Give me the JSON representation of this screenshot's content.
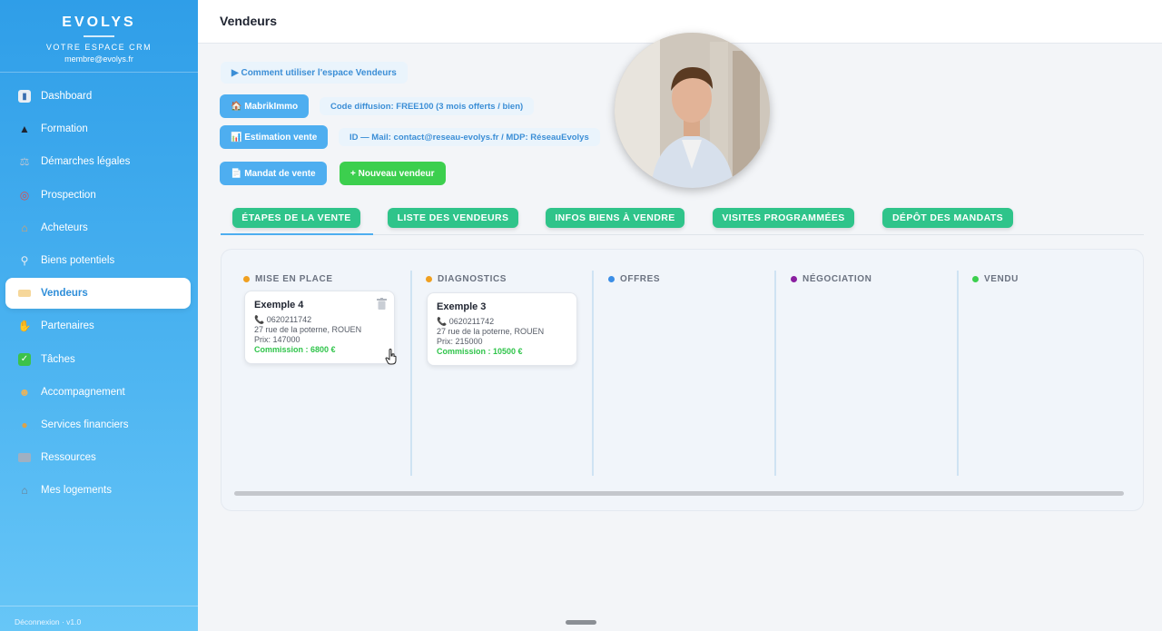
{
  "brand": {
    "title": "EVOLYS",
    "subtitle": "VOTRE ESPACE CRM",
    "email": "membre@evolys.fr"
  },
  "sidebar": {
    "items": [
      {
        "label": "Dashboard",
        "icon": "chart-icon"
      },
      {
        "label": "Formation",
        "icon": "graduation-cap-icon"
      },
      {
        "label": "Démarches légales",
        "icon": "scales-icon"
      },
      {
        "label": "Prospection",
        "icon": "target-icon"
      },
      {
        "label": "Acheteurs",
        "icon": "house-icon"
      },
      {
        "label": "Biens potentiels",
        "icon": "magnifier-icon"
      },
      {
        "label": "Vendeurs",
        "icon": "tag-icon",
        "active": true
      },
      {
        "label": "Partenaires",
        "icon": "handshake-icon"
      },
      {
        "label": "Tâches",
        "icon": "check-icon"
      },
      {
        "label": "Accompagnement",
        "icon": "people-icon"
      },
      {
        "label": "Services financiers",
        "icon": "money-bag-icon"
      },
      {
        "label": "Ressources",
        "icon": "folder-icon"
      },
      {
        "label": "Mes logements",
        "icon": "houses-icon"
      }
    ],
    "footer": "Déconnexion · v1.0"
  },
  "header": {
    "title": "Vendeurs"
  },
  "help_link": "▶ Comment utiliser l'espace Vendeurs",
  "actions": {
    "mabrikimmo": "🏠 MabrikImmo",
    "mabrikimmo_info": "Code diffusion: FREE100 (3 mois offerts / bien)",
    "estimation": "📊 Estimation vente",
    "estimation_info": "ID — Mail: contact@reseau-evolys.fr / MDP: RéseauEvolys",
    "mandat": "📄 Mandat de vente",
    "new_seller": "+ Nouveau vendeur"
  },
  "tabs": [
    {
      "label": "ÉTAPES DE LA VENTE",
      "active": true
    },
    {
      "label": "LISTE DES VENDEURS"
    },
    {
      "label": "INFOS BIENS À VENDRE"
    },
    {
      "label": "VISITES PROGRAMMÉES"
    },
    {
      "label": "DÉPÔT DES MANDATS"
    }
  ],
  "columns": [
    {
      "title": "MISE EN PLACE",
      "color": "#f0a020"
    },
    {
      "title": "DIAGNOSTICS",
      "color": "#f0a020"
    },
    {
      "title": "OFFRES",
      "color": "#3b8ee6"
    },
    {
      "title": "NÉGOCIATION",
      "color": "#8a1fa0"
    },
    {
      "title": "VENDU",
      "color": "#3ccf4e"
    }
  ],
  "cards": [
    {
      "title": "Exemple 4",
      "phone": "📞 0620211742",
      "address": "27 rue de la poterne, ROUEN",
      "price": "Prix: 147000",
      "commission": "Commission : 6800 €"
    },
    {
      "title": "Exemple 3",
      "phone": "📞 0620211742",
      "address": "27 rue de la poterne, ROUEN",
      "price": "Prix: 215000",
      "commission": "Commission : 10500 €"
    }
  ]
}
